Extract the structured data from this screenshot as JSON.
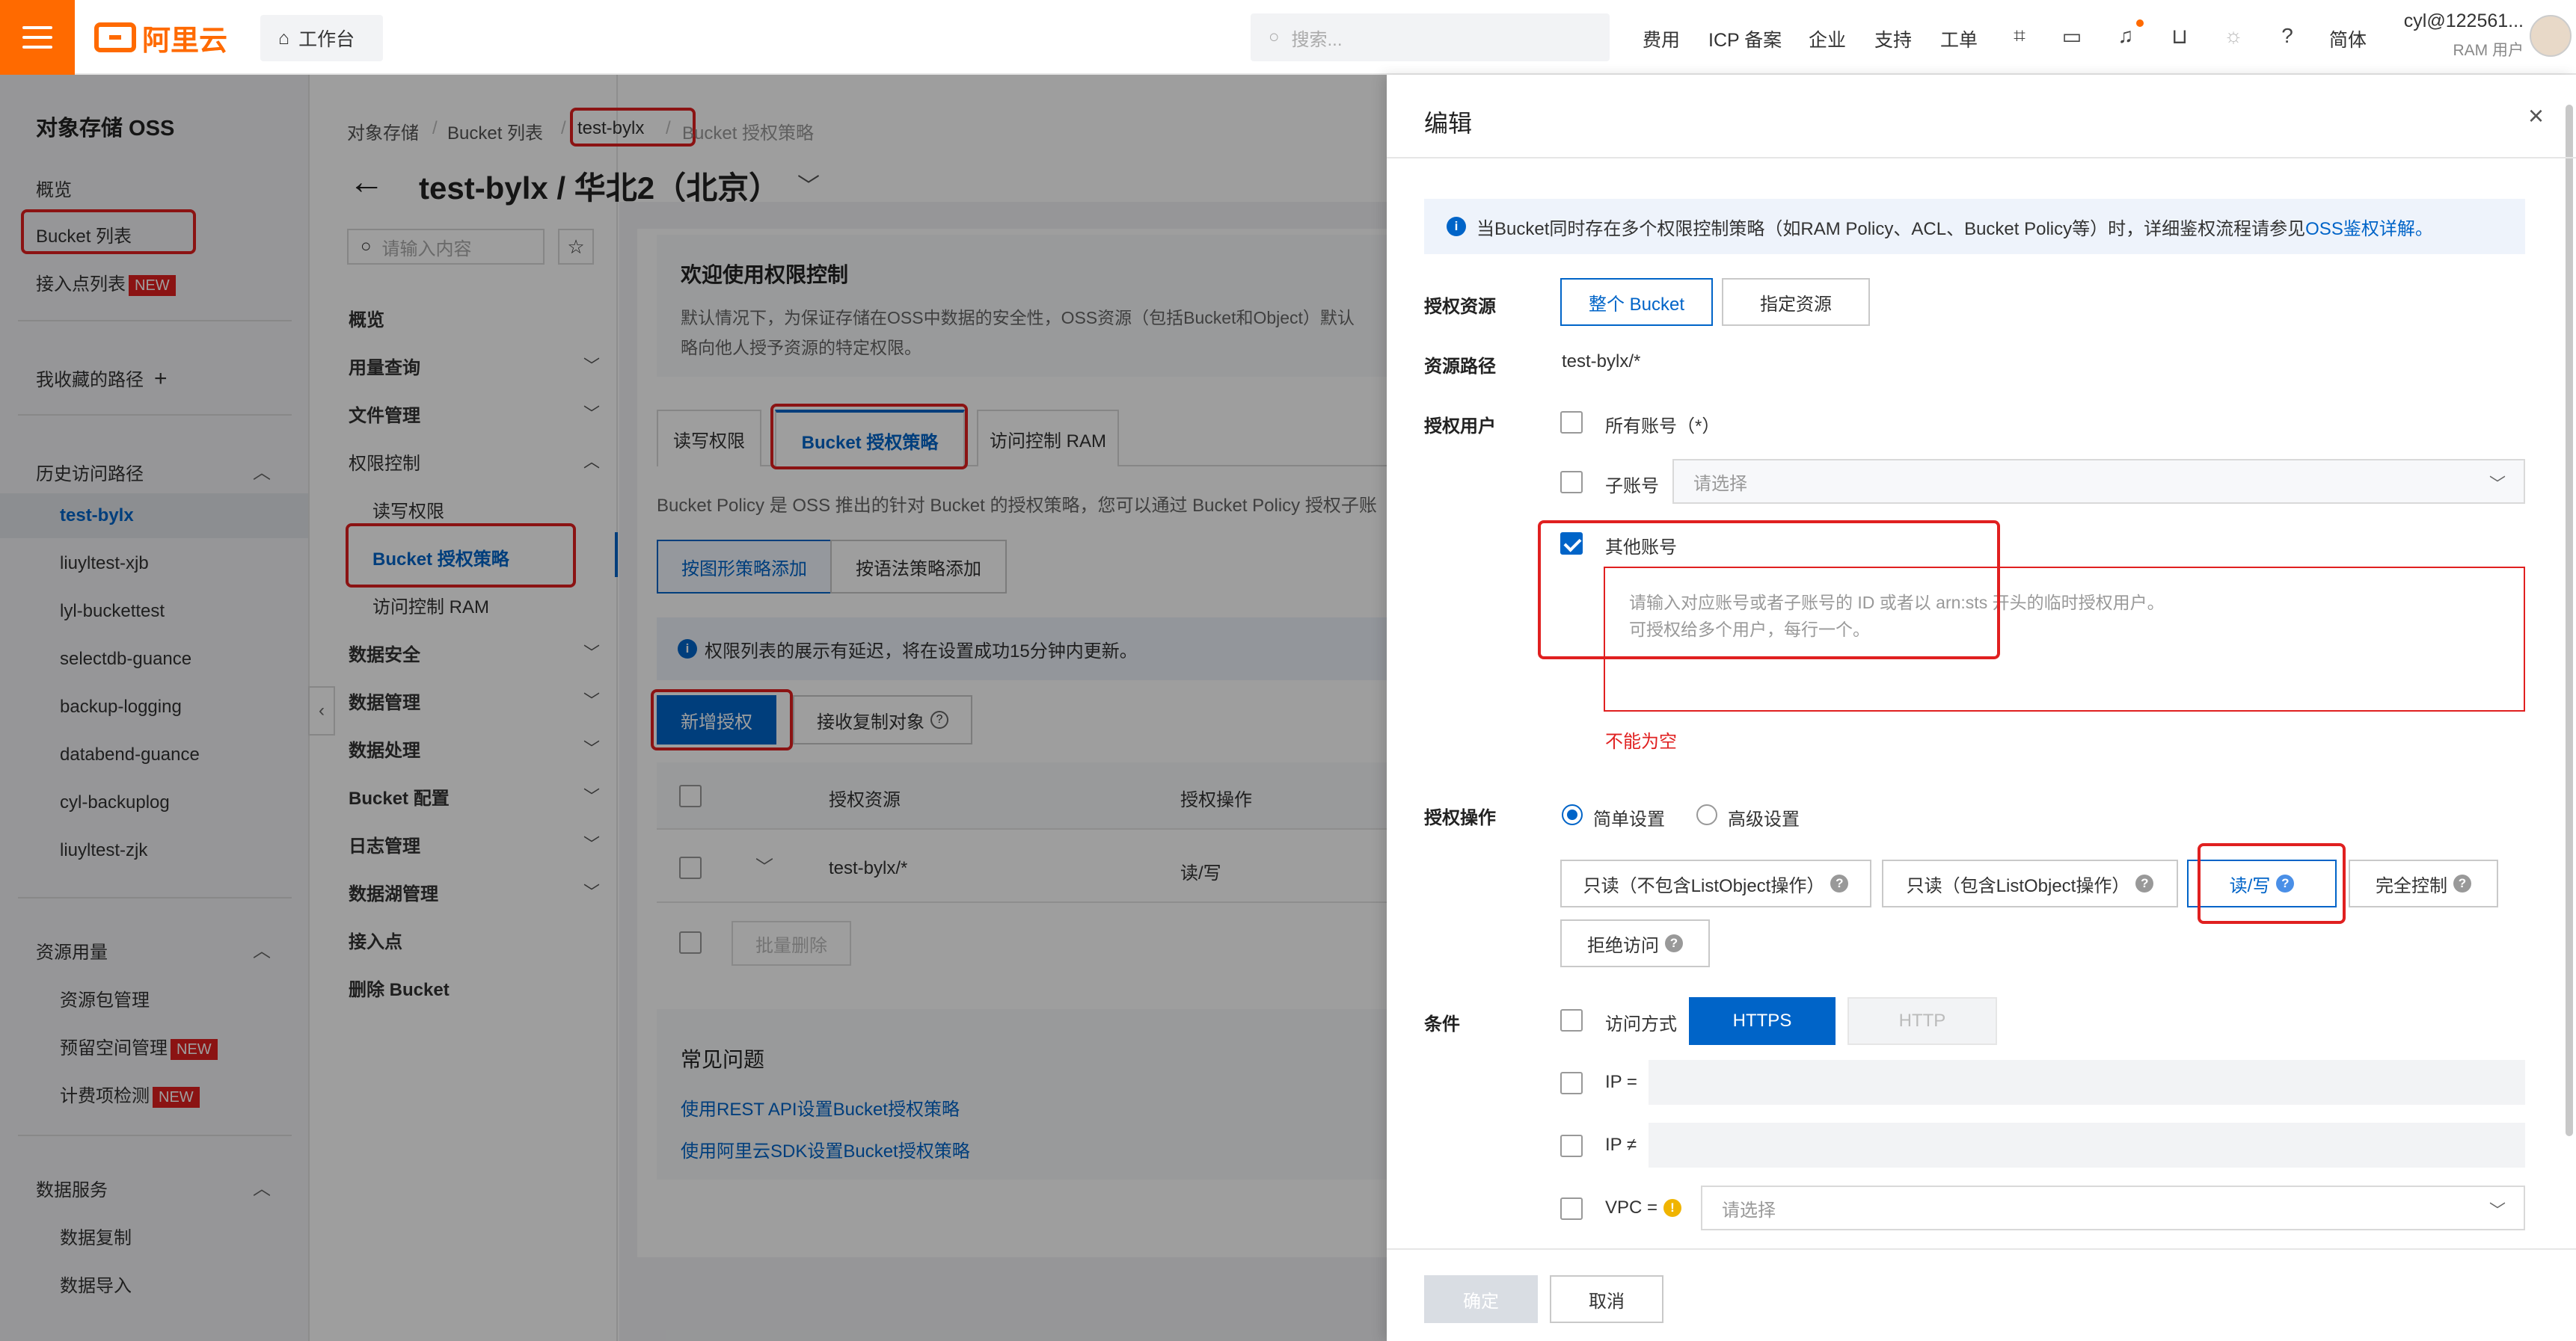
{
  "header": {
    "brand": "阿里云",
    "workbench": "工作台",
    "search_placeholder": "搜索...",
    "links": [
      "费用",
      "ICP 备案",
      "企业",
      "支持",
      "工单",
      "简体"
    ],
    "user_name": "cyl@122561...",
    "user_role": "RAM 用户"
  },
  "sidebar": {
    "title": "对象存储 OSS",
    "overview": "概览",
    "bucket_list": "Bucket 列表",
    "access_points": "接入点列表",
    "new_tag": "NEW",
    "favorites": "我收藏的路径",
    "history_title": "历史访问路径",
    "history": [
      "test-bylx",
      "liuyltest-xjb",
      "lyl-buckettest",
      "selectdb-guance",
      "backup-logging",
      "databend-guance",
      "cyl-backuplog",
      "liuyltest-zjk"
    ],
    "resource_usage": "资源用量",
    "resource_items": [
      "资源包管理",
      "预留空间管理",
      "计费项检测"
    ],
    "data_services": "数据服务",
    "data_items": [
      "数据复制",
      "数据导入"
    ]
  },
  "breadcrumb": [
    "对象存储",
    "Bucket 列表",
    "test-bylx",
    "Bucket 授权策略"
  ],
  "page_title": "test-bylx / 华北2（北京）",
  "subnav": {
    "search_placeholder": "请输入内容",
    "items": {
      "overview": "概览",
      "usage": "用量查询",
      "files": "文件管理",
      "permission": "权限控制",
      "rw_perm": "读写权限",
      "bucket_policy": "Bucket 授权策略",
      "ram": "访问控制 RAM",
      "security": "数据安全",
      "data_mgmt": "数据管理",
      "processing": "数据处理",
      "config": "Bucket 配置",
      "logs": "日志管理",
      "lake": "数据湖管理",
      "access_point": "接入点",
      "delete": "删除 Bucket"
    }
  },
  "main": {
    "welcome_title": "欢迎使用权限控制",
    "welcome_line1": "默认情况下，为保证存储在OSS中数据的安全性，OSS资源（包括Bucket和Object）默认",
    "welcome_line2": "略向他人授予资源的特定权限。",
    "tabs": [
      "读写权限",
      "Bucket 授权策略",
      "访问控制 RAM"
    ],
    "policy_desc": "Bucket Policy 是 OSS 推出的针对 Bucket 的授权策略，您可以通过 Bucket Policy 授权子账",
    "add_modes": [
      "按图形策略添加",
      "按语法策略添加"
    ],
    "notice": "权限列表的展示有延迟，将在设置成功15分钟内更新。",
    "add_button": "新增授权",
    "receive_button": "接收复制对象",
    "table_headers": [
      "授权资源",
      "授权操作"
    ],
    "row": {
      "resource": "test-bylx/*",
      "action": "读/写"
    },
    "batch_delete": "批量删除",
    "faq_title": "常见问题",
    "faq": [
      "使用REST API设置Bucket授权策略",
      "使用阿里云SDK设置Bucket授权策略"
    ]
  },
  "drawer": {
    "title": "编辑",
    "info_text": "当Bucket同时存在多个权限控制策略（如RAM Policy、ACL、Bucket Policy等）时，详细鉴权流程请参见",
    "info_link": "OSS鉴权详解。",
    "resource_label": "授权资源",
    "resource_options": [
      "整个 Bucket",
      "指定资源"
    ],
    "path_label": "资源路径",
    "path_value": "test-bylx/*",
    "user_label": "授权用户",
    "all_accounts": "所有账号（*）",
    "sub_account": "子账号",
    "select_placeholder": "请选择",
    "other_accounts": "其他账号",
    "other_placeholder_1": "请输入对应账号或者子账号的 ID 或者以 arn:sts 开头的临时授权用户。",
    "other_placeholder_2": "可授权给多个用户，每行一个。",
    "error": "不能为空",
    "action_label": "授权操作",
    "simple": "简单设置",
    "advanced": "高级设置",
    "actions": [
      "只读（不包含ListObject操作）",
      "只读（包含ListObject操作）",
      "读/写",
      "完全控制",
      "拒绝访问"
    ],
    "condition_label": "条件",
    "access_method": "访问方式",
    "https": "HTTPS",
    "http": "HTTP",
    "ip_eq": "IP =",
    "ip_ne": "IP ≠",
    "vpc": "VPC =",
    "confirm": "确定",
    "cancel": "取消"
  }
}
